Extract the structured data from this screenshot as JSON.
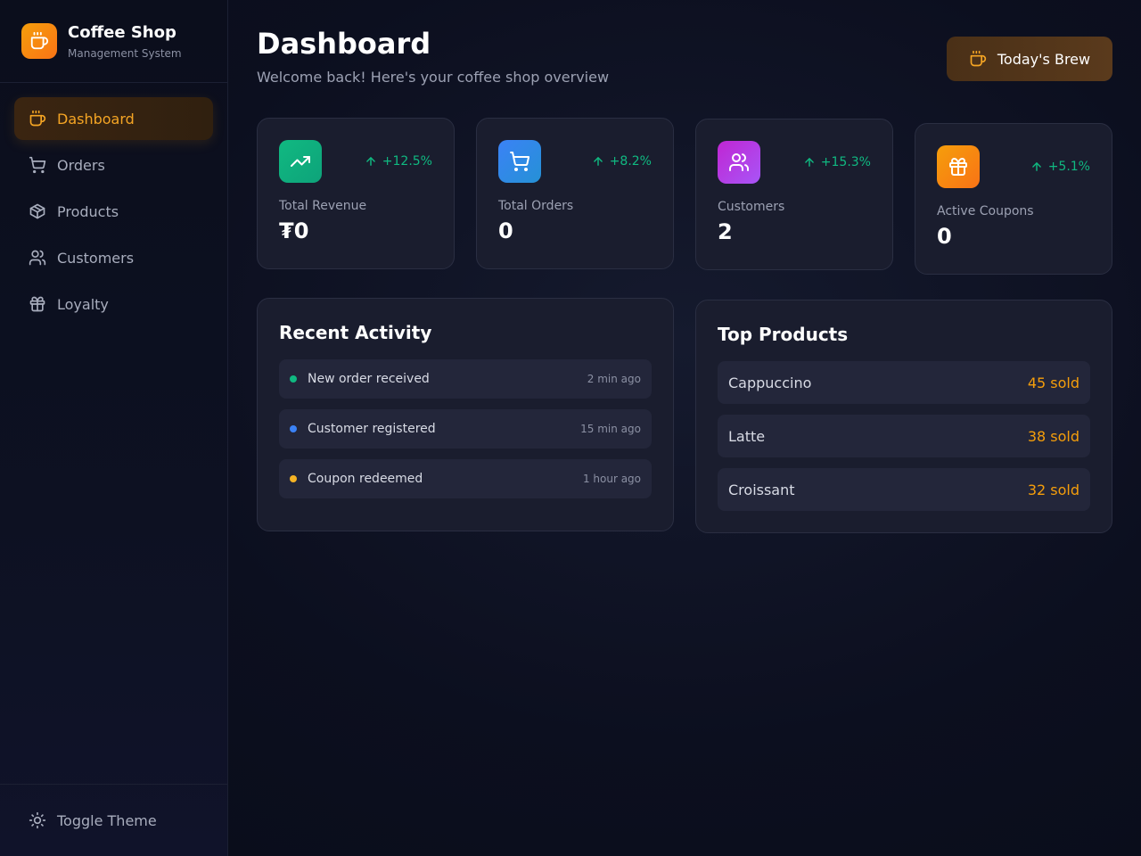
{
  "brand": {
    "title": "Coffee Shop",
    "subtitle": "Management System",
    "logo_icon": "coffee-cup-icon",
    "accent": "#f59e0b"
  },
  "sidebar": {
    "items": [
      {
        "label": "Dashboard",
        "icon": "coffee-cup-icon",
        "active": true
      },
      {
        "label": "Orders",
        "icon": "cart-icon",
        "active": false
      },
      {
        "label": "Products",
        "icon": "package-icon",
        "active": false
      },
      {
        "label": "Customers",
        "icon": "users-icon",
        "active": false
      },
      {
        "label": "Loyalty",
        "icon": "gift-icon",
        "active": false
      }
    ],
    "footer": {
      "label": "Toggle Theme",
      "icon": "sun-icon"
    }
  },
  "header": {
    "title": "Dashboard",
    "subtitle": "Welcome back! Here's your coffee shop overview",
    "brew_button": "Today's Brew"
  },
  "stats": [
    {
      "label": "Total Revenue",
      "value": "₮0",
      "change": "+12.5%",
      "icon": "trending-up-icon",
      "color": "#10b981"
    },
    {
      "label": "Total Orders",
      "value": "0",
      "change": "+8.2%",
      "icon": "cart-icon",
      "color": "#3b82f6"
    },
    {
      "label": "Customers",
      "value": "2",
      "change": "+15.3%",
      "icon": "users-icon",
      "color": "#c026d3"
    },
    {
      "label": "Active Coupons",
      "value": "0",
      "change": "+5.1%",
      "icon": "gift-icon",
      "color": "#f97316"
    }
  ],
  "recent_activity": {
    "title": "Recent Activity",
    "items": [
      {
        "text": "New order received",
        "time": "2 min ago",
        "dot_color": "#10b981"
      },
      {
        "text": "Customer registered",
        "time": "15 min ago",
        "dot_color": "#3b82f6"
      },
      {
        "text": "Coupon redeemed",
        "time": "1 hour ago",
        "dot_color": "#f5b324"
      }
    ]
  },
  "top_products": {
    "title": "Top Products",
    "items": [
      {
        "name": "Cappuccino",
        "sold": "45 sold"
      },
      {
        "name": "Latte",
        "sold": "38 sold"
      },
      {
        "name": "Croissant",
        "sold": "32 sold"
      }
    ]
  }
}
